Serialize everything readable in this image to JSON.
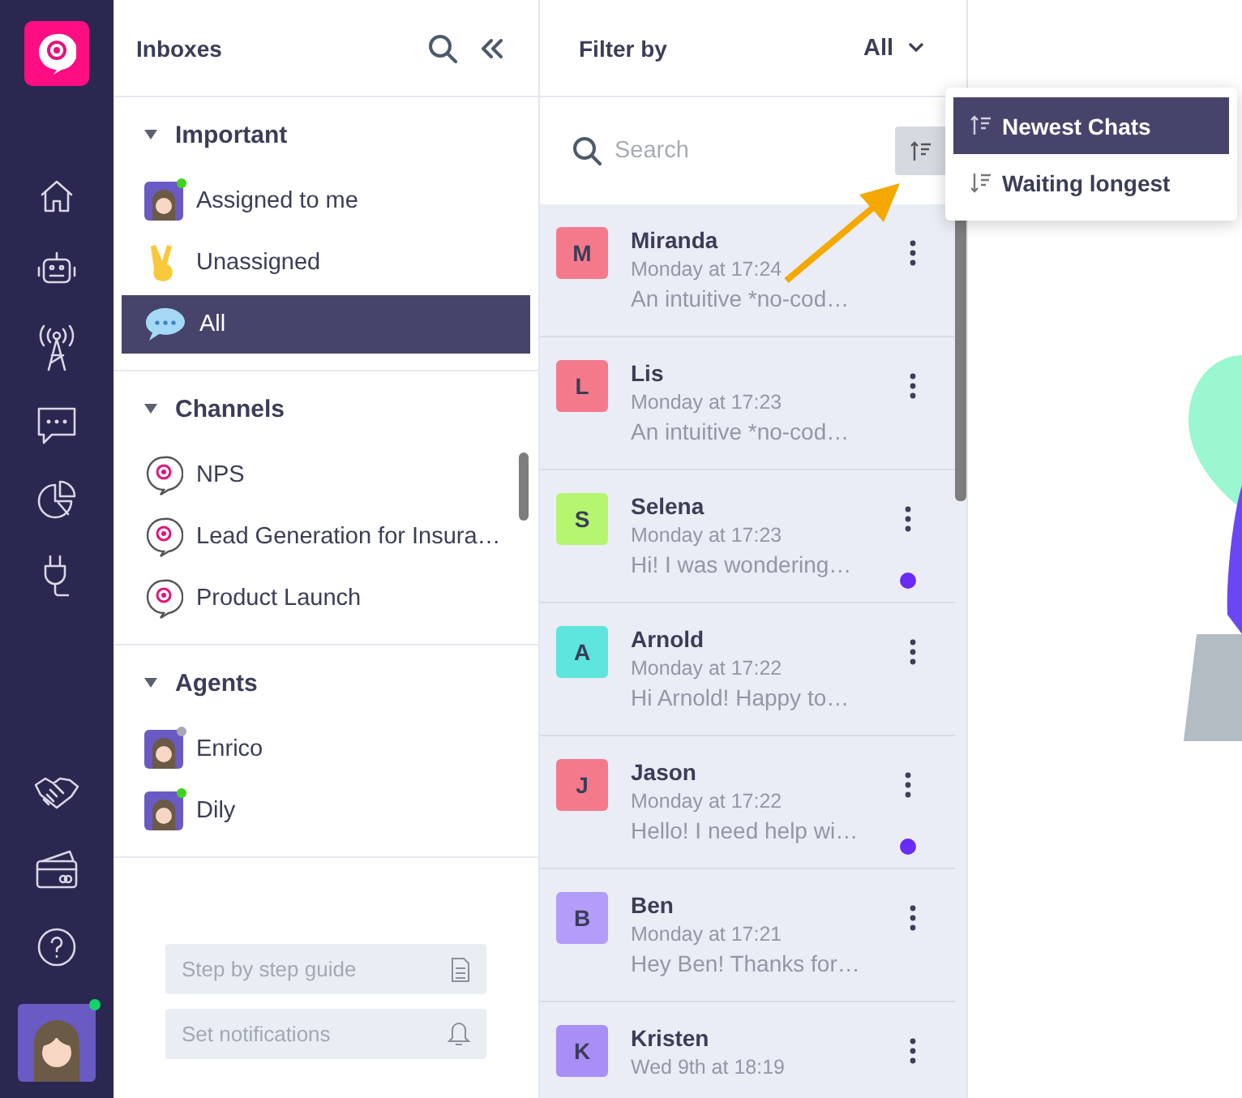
{
  "inboxes": {
    "title": "Inboxes",
    "sections": [
      {
        "title": "Important",
        "expanded": true,
        "items": [
          {
            "label": "Assigned to me",
            "kind": "avatar",
            "online": true,
            "selected": false
          },
          {
            "label": "Unassigned",
            "kind": "hand",
            "selected": false
          },
          {
            "label": "All",
            "kind": "bubble",
            "selected": true
          }
        ]
      },
      {
        "title": "Channels",
        "expanded": true,
        "items": [
          {
            "label": "NPS",
            "kind": "channel",
            "selected": false
          },
          {
            "label": "Lead Generation for Insura…",
            "kind": "channel",
            "selected": false
          },
          {
            "label": "Product Launch",
            "kind": "channel",
            "selected": false
          }
        ]
      },
      {
        "title": "Agents",
        "expanded": true,
        "items": [
          {
            "label": "Enrico",
            "kind": "avatar",
            "online": false,
            "selected": false
          },
          {
            "label": "Dily",
            "kind": "avatar",
            "online": true,
            "selected": false
          }
        ]
      }
    ],
    "guides": [
      {
        "label": "Step by step guide",
        "kind": "document"
      },
      {
        "label": "Set notifications",
        "kind": "bell"
      }
    ]
  },
  "chat_list": {
    "filter_label": "Filter by",
    "filter_value": "All",
    "search": {
      "placeholder": "Search"
    },
    "chats": [
      {
        "initial": "M",
        "name": "Miranda",
        "time": "Monday at 17:24",
        "preview": "An intuitive *no-cod…",
        "unread": false,
        "color": "#f47a8b"
      },
      {
        "initial": "L",
        "name": "Lis",
        "time": "Monday at 17:23",
        "preview": "An intuitive *no-cod…",
        "unread": false,
        "color": "#f47a8b"
      },
      {
        "initial": "S",
        "name": "Selena",
        "time": "Monday at 17:23",
        "preview": "Hi! I was wondering…",
        "unread": true,
        "color": "#b5f56f"
      },
      {
        "initial": "A",
        "name": "Arnold",
        "time": "Monday at 17:22",
        "preview": "Hi Arnold! Happy to…",
        "unread": false,
        "color": "#5ee5dd"
      },
      {
        "initial": "J",
        "name": "Jason",
        "time": "Monday at 17:22",
        "preview": "Hello! I need help wi…",
        "unread": true,
        "color": "#f47a8b"
      },
      {
        "initial": "B",
        "name": "Ben",
        "time": "Monday at 17:21",
        "preview": "Hey Ben! Thanks for…",
        "unread": false,
        "color": "#b49cfa"
      },
      {
        "initial": "K",
        "name": "Kristen",
        "time": "Wed 9th at 18:19",
        "unread": false,
        "color": "#a98ef5"
      }
    ]
  },
  "sort_menu": [
    {
      "label": "Newest Chats",
      "kind": "newest",
      "selected": true
    },
    {
      "label": "Waiting longest",
      "kind": "longest",
      "selected": false
    }
  ],
  "user": {
    "online": true
  }
}
